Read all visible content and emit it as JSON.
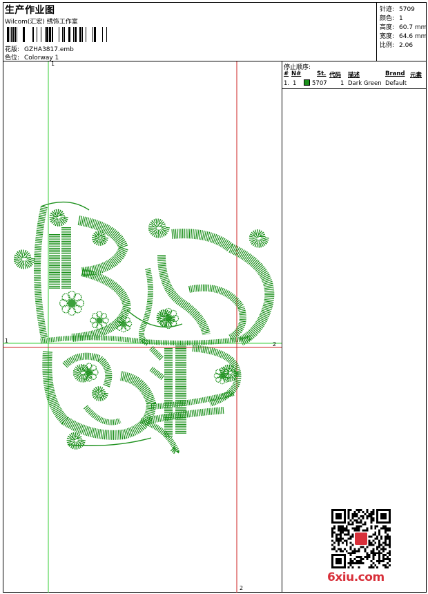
{
  "header": {
    "title": "生产作业图",
    "studio": "Wilcom(汇宏) 绣饰工作室",
    "design_label": "花版:",
    "design_value": "GZHA3817.emb",
    "colorway_label": "色位:",
    "colorway_value": "Colorway 1"
  },
  "stats": [
    {
      "label": "针迹:",
      "value": "5709"
    },
    {
      "label": "颜色:",
      "value": "1"
    },
    {
      "label": "高度:",
      "value": "60.7 mm"
    },
    {
      "label": "宽度:",
      "value": "64.6 mm"
    },
    {
      "label": "比例:",
      "value": "2.06"
    }
  ],
  "stop_sequence": {
    "title": "停止顺序:",
    "columns": [
      "#",
      "N#",
      "St.",
      "代码",
      "描述",
      "Brand",
      "元素"
    ],
    "rows": [
      {
        "index": "1.",
        "n": "1",
        "swatch_color": "#1a8f1a",
        "stitches": "5707",
        "code": "1",
        "description": "Dark Green",
        "brand": "Default"
      }
    ]
  },
  "axis_labels": {
    "vertical_top": "1",
    "horizontal_left": "1",
    "horizontal_right": "2",
    "vertical_bottom": "2"
  },
  "colors": {
    "thread": "#1a8f1a",
    "guide_green": "#33cc33",
    "guide_red": "#cc2222",
    "logo_red": "#d8303a"
  },
  "footer": {
    "logo_text": "6xiu.com"
  }
}
